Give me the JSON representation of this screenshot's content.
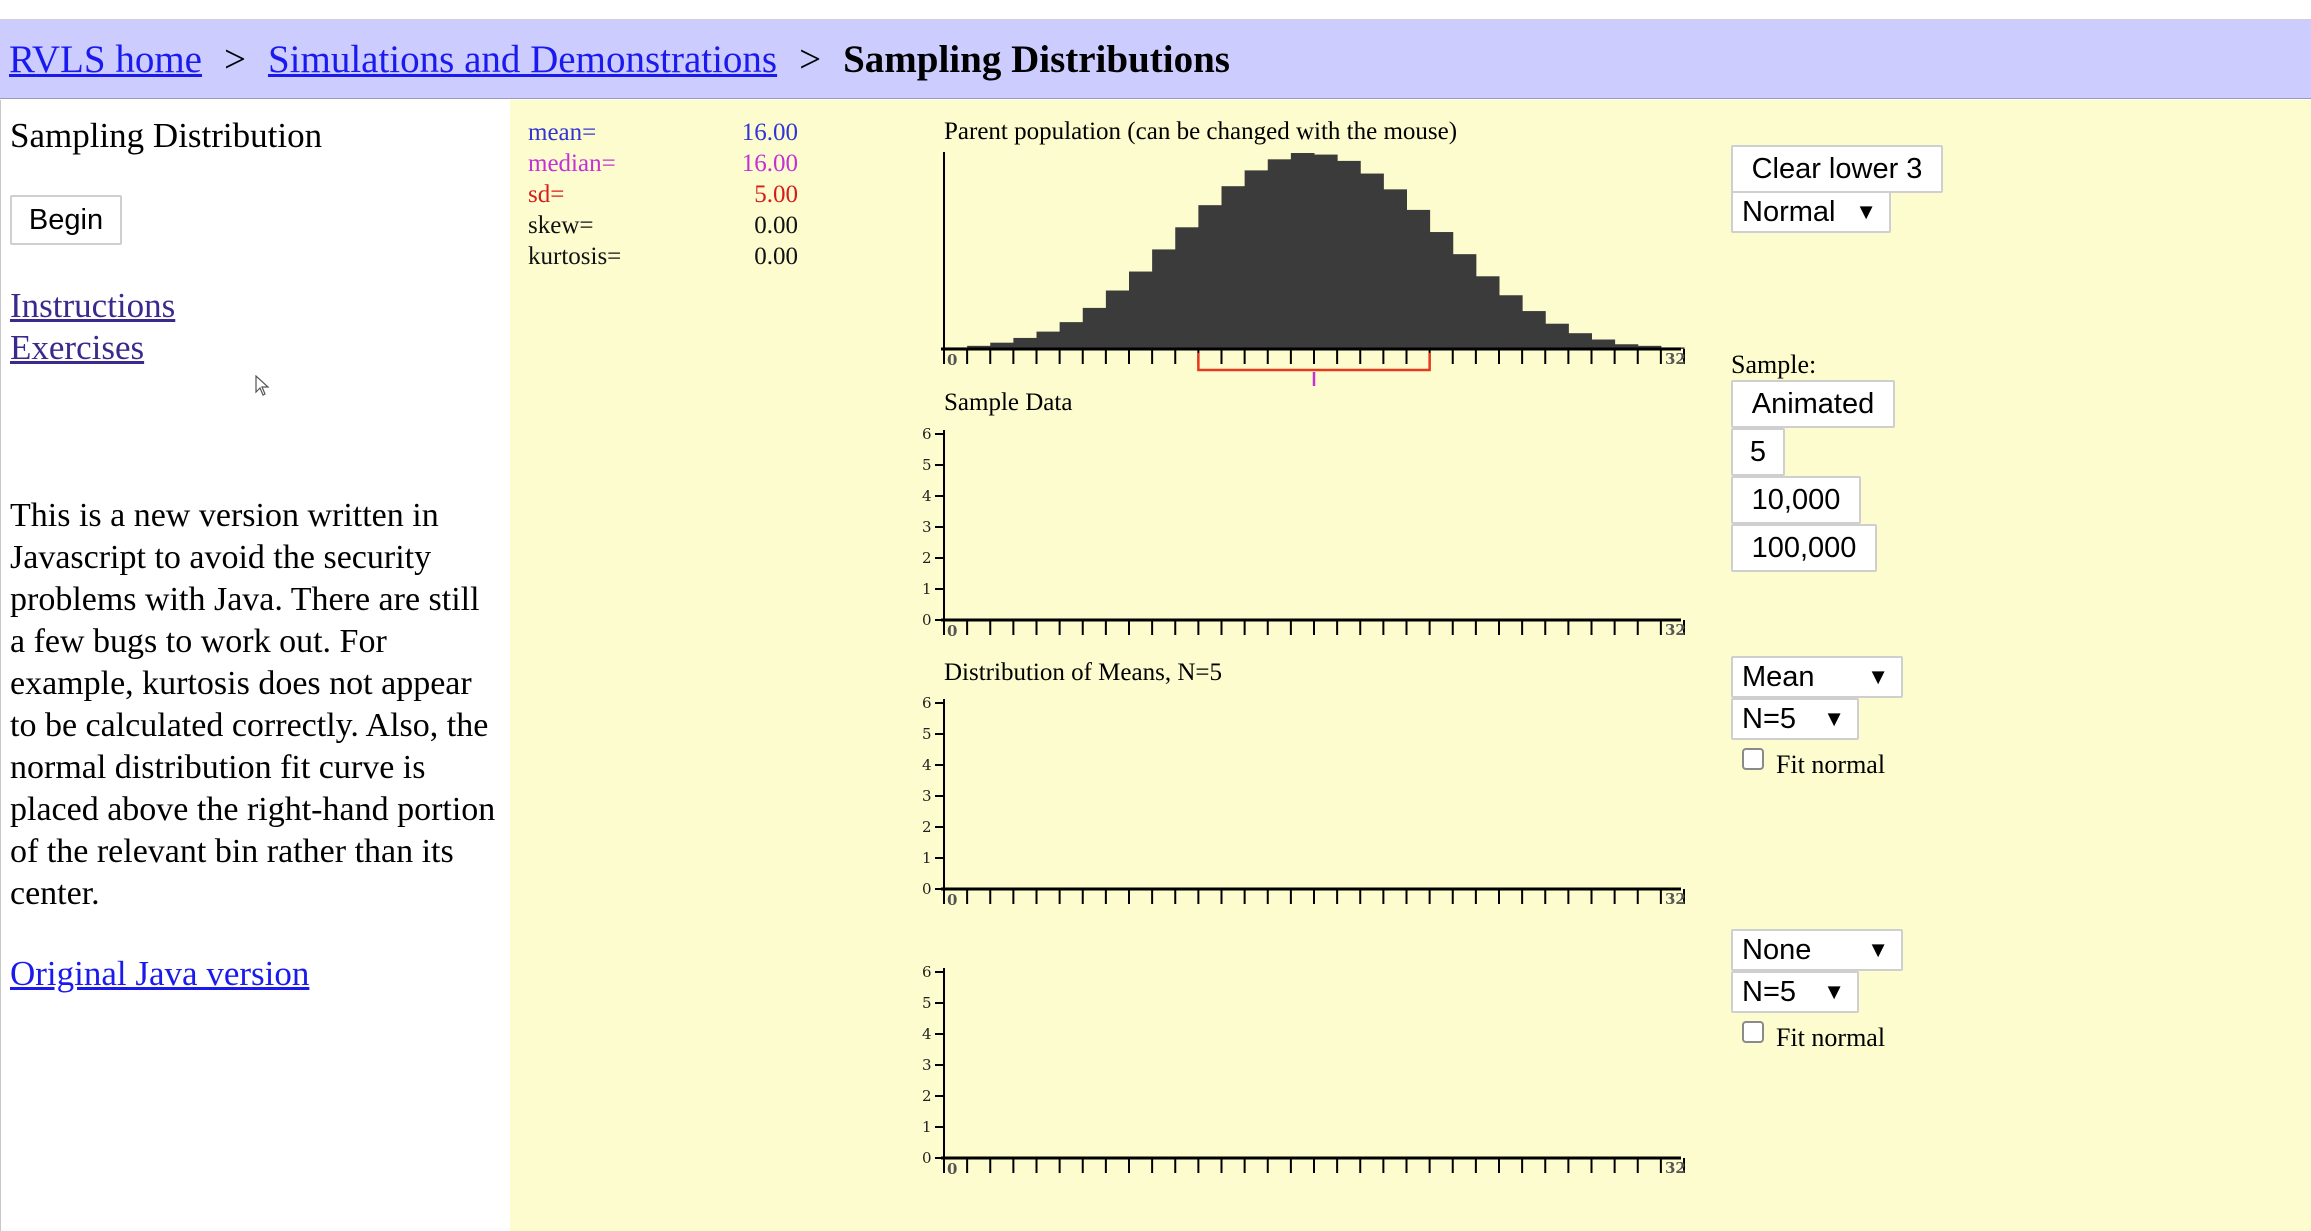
{
  "breadcrumb": {
    "home": "RVLS home",
    "section": "Simulations and Demonstrations",
    "current": "Sampling Distributions",
    "separator": ">"
  },
  "left": {
    "title": "Sampling Distribution",
    "begin_label": "Begin",
    "instructions_label": "Instructions",
    "exercises_label": "Exercises",
    "description": "This is a new version written in Javascript to avoid the security problems with Java. There are still a few bugs to work out. For example, kurtosis does not appear to be calculated correctly. Also, the normal distribution fit curve is placed above the right-hand portion of the relevant bin rather than its center.",
    "java_link": "Original Java version"
  },
  "stats": [
    {
      "label": "mean=",
      "value": "16.00",
      "color": "#3434d6"
    },
    {
      "label": "median=",
      "value": "16.00",
      "color": "#c430d8"
    },
    {
      "label": "sd=",
      "value": "5.00",
      "color": "#d81b1b"
    },
    {
      "label": "skew=",
      "value": "0.00",
      "color": "#111111"
    },
    {
      "label": "kurtosis=",
      "value": "0.00",
      "color": "#111111"
    }
  ],
  "plots": {
    "parent_title": "Parent population (can be changed with the mouse)",
    "sample_title": "Sample Data",
    "means_title": "Distribution of Means, N=5",
    "axis_min_label": "0",
    "axis_max_label": "32",
    "y_tick_labels": [
      "0",
      "1",
      "2",
      "3",
      "4",
      "5",
      "6"
    ]
  },
  "controls": {
    "clear_label": "Clear lower 3",
    "population_select": "Normal",
    "sample_label": "Sample:",
    "animated_label": "Animated",
    "five_label": "5",
    "ten_thousand_label": "10,000",
    "hundred_thousand_label": "100,000",
    "stat_select_1": "Mean",
    "n_select_1": "N=5",
    "fit_normal_1": "Fit normal",
    "stat_select_2": "None",
    "n_select_2": "N=5",
    "fit_normal_2": "Fit normal"
  },
  "chart_data": {
    "type": "bar",
    "title": "Parent population (can be changed with the mouse)",
    "x_range": [
      0,
      32
    ],
    "population_mean": 16,
    "population_sd": 5,
    "bar_color": "#3b3b3b",
    "sd_bracket_color": "#e8381e",
    "median_marker_color": "#c430d8",
    "values": [
      1,
      2,
      4,
      7,
      11,
      17,
      26,
      37,
      49,
      63,
      77,
      91,
      103,
      113,
      120,
      124,
      123,
      119,
      111,
      101,
      88,
      74,
      60,
      46,
      34,
      24,
      16,
      10,
      6,
      3,
      2,
      1
    ]
  }
}
